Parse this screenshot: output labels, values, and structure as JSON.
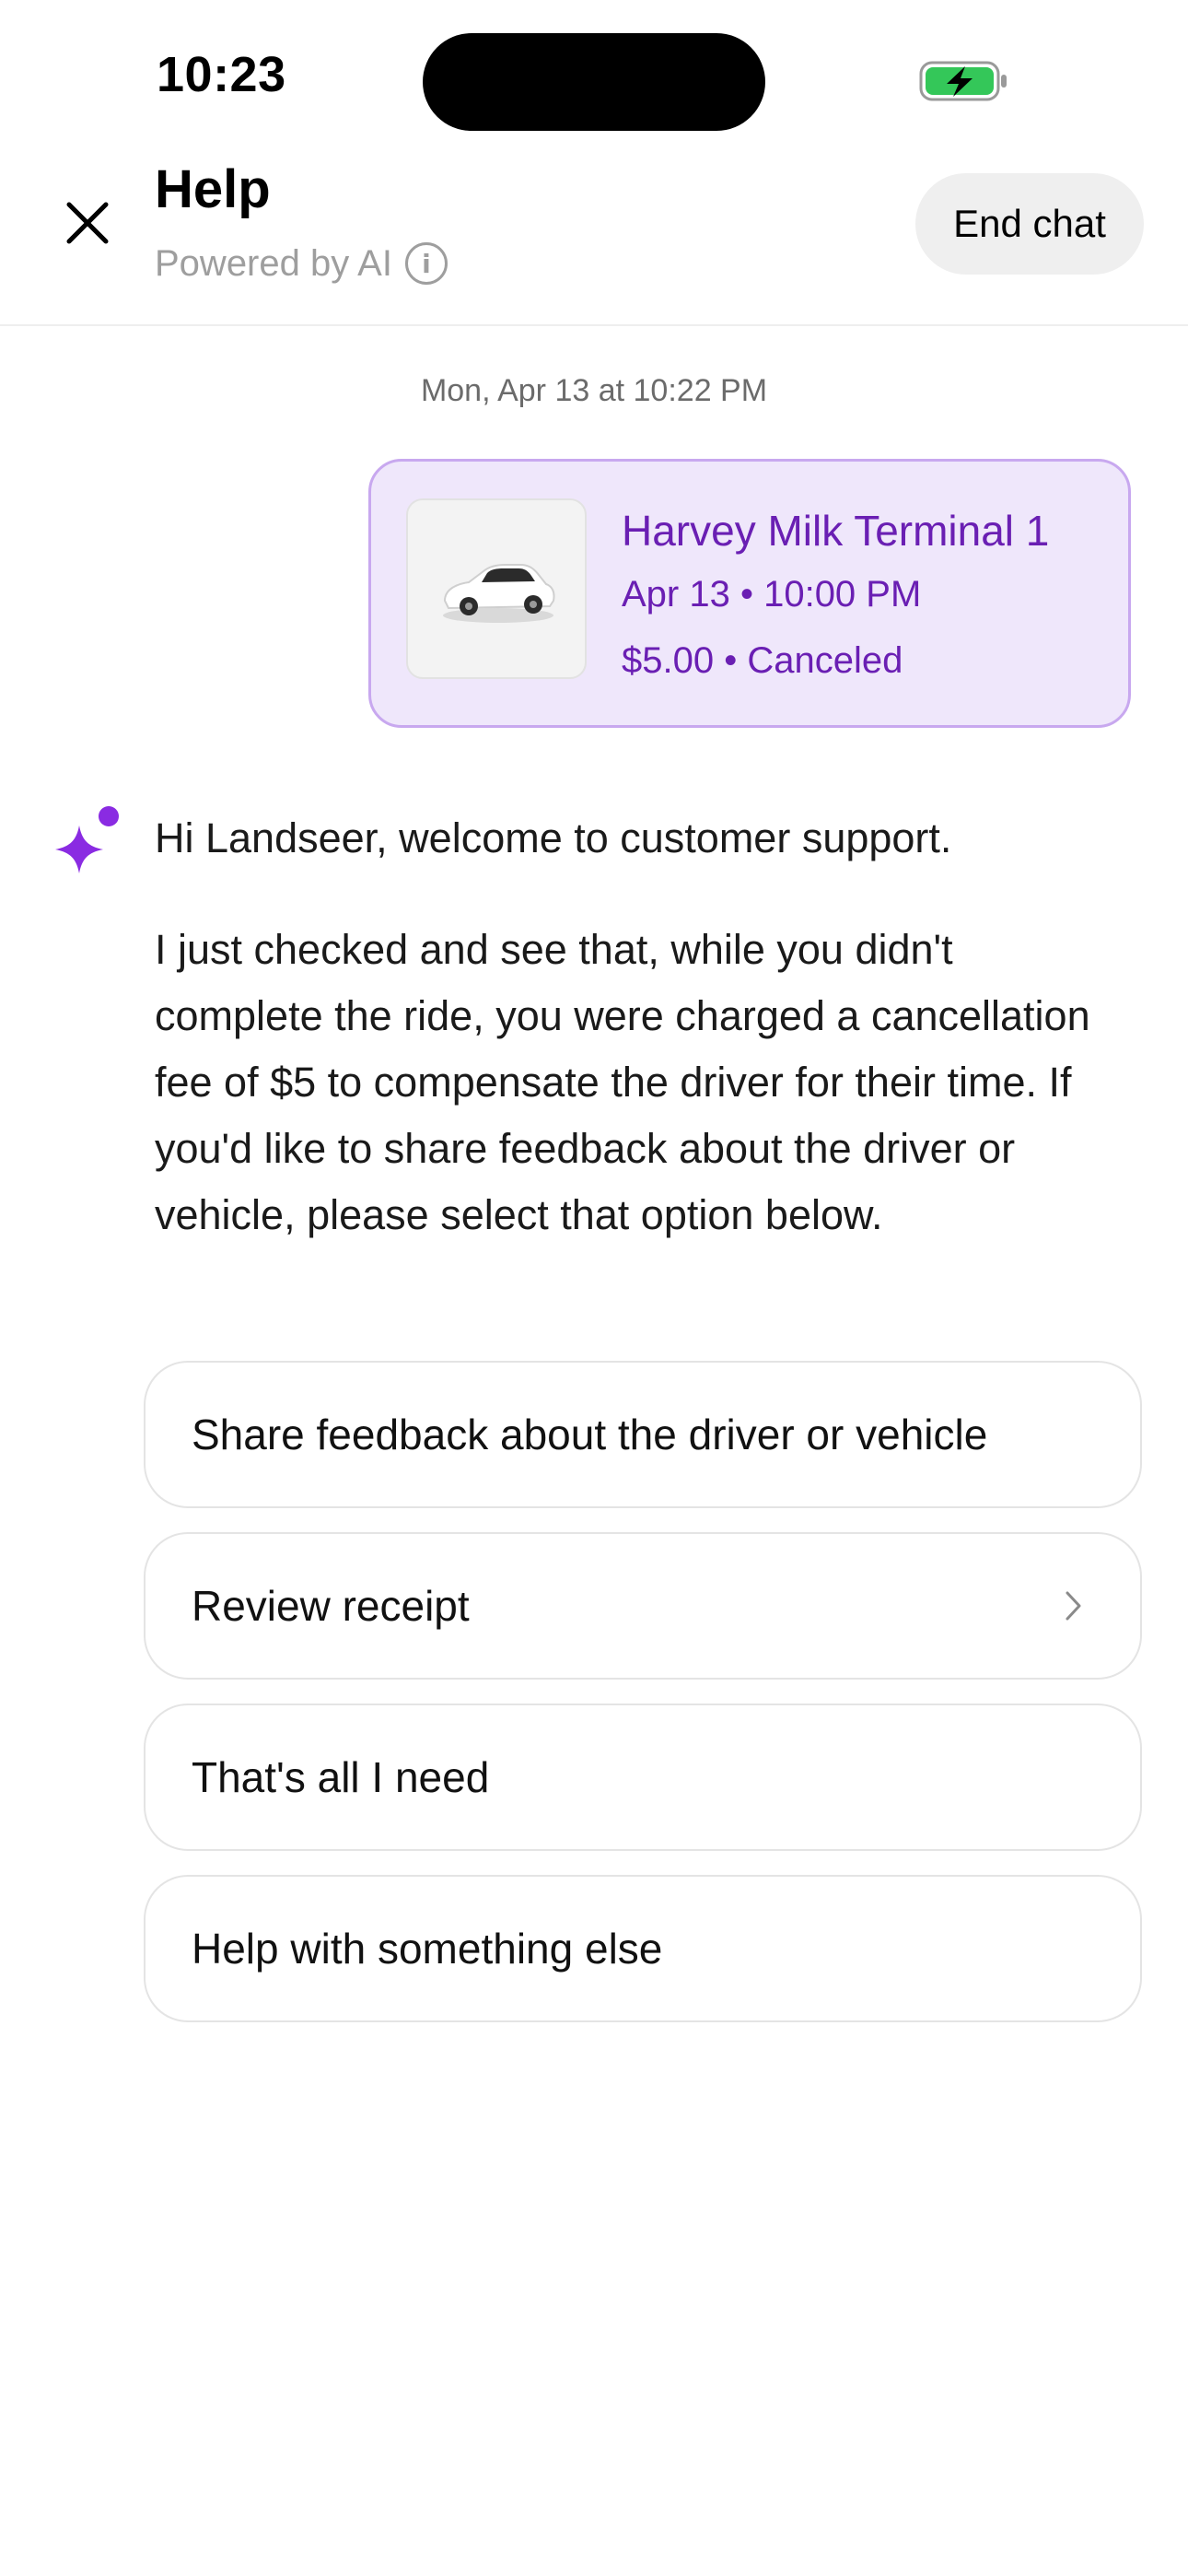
{
  "status_bar": {
    "time": "10:23",
    "battery_color": "#34c759"
  },
  "header": {
    "title": "Help",
    "subtitle": "Powered by AI",
    "end_chat_label": "End chat"
  },
  "chat": {
    "timestamp": "Mon, Apr 13 at 10:22 PM",
    "trip_card": {
      "title": "Harvey Milk Terminal 1",
      "date_time": "Apr 13 • 10:00 PM",
      "fare_status": "$5.00 • Canceled",
      "accent_color": "#6a1fb3"
    },
    "assistant": {
      "icon": "sparkle-icon",
      "greeting": "Hi Landseer, welcome to customer support.",
      "body": "I just checked and see that, while you didn't complete the ride, you were charged a cancellation fee of $5 to compensate the driver for their time. If you'd like to share feedback about the driver or vehicle, please select that option below."
    },
    "options": [
      {
        "label": "Share feedback about the driver or vehicle"
      },
      {
        "label": "Review receipt",
        "icon": "chevron-right-icon"
      },
      {
        "label": "That's all I need"
      },
      {
        "label": "Help with something else"
      }
    ]
  }
}
